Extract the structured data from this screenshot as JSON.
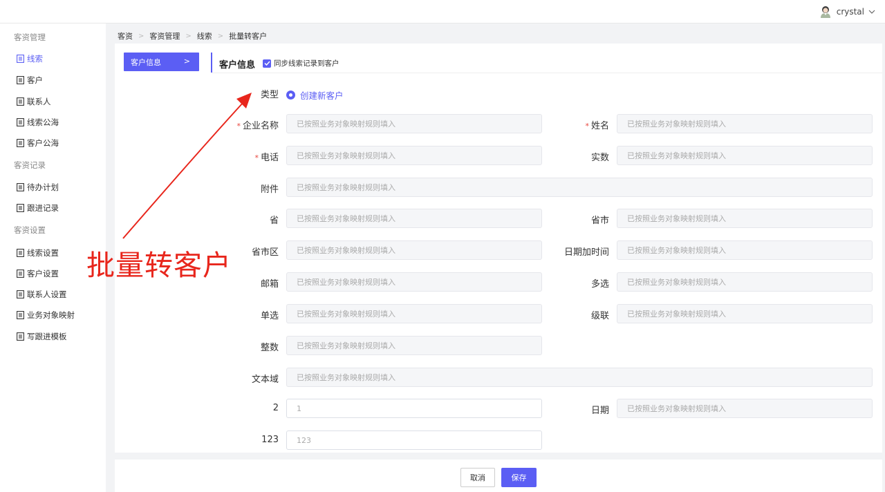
{
  "header": {
    "username": "crystal",
    "dropdown_icon": "chevron-down-icon",
    "avatar_icon": "user-avatar-icon"
  },
  "sidebar": {
    "groups": [
      {
        "label": "客资管理"
      },
      {
        "label": "客资记录"
      },
      {
        "label": "客资设置"
      }
    ],
    "items": [
      {
        "label": "线索",
        "active": true
      },
      {
        "label": "客户"
      },
      {
        "label": "联系人"
      },
      {
        "label": "线索公海"
      },
      {
        "label": "客户公海"
      },
      {
        "label": "待办计划"
      },
      {
        "label": "跟进记录"
      },
      {
        "label": "线索设置"
      },
      {
        "label": "客户设置"
      },
      {
        "label": "联系人设置"
      },
      {
        "label": "业务对象映射"
      },
      {
        "label": "写跟进模板"
      }
    ]
  },
  "breadcrumb": [
    "客资",
    "客资管理",
    "线索",
    "批量转客户"
  ],
  "step": {
    "label": "客户信息",
    "chevron": ">"
  },
  "section": {
    "title": "客户信息",
    "sync_label": "同步线索记录到客户",
    "sync_checked": true
  },
  "form": {
    "type_label": "类型",
    "type_value": "创建新客户",
    "placeholder": "已按照业务对象映射规则填入",
    "fields": {
      "company": "企业名称",
      "name": "姓名",
      "phone": "电话",
      "actual": "实数",
      "attachment": "附件",
      "province": "省",
      "province_city": "省市",
      "province_city_district": "省市区",
      "datetime": "日期加时间",
      "email": "邮箱",
      "multi": "多选",
      "single": "单选",
      "cascade": "级联",
      "integer": "整数",
      "textarea": "文本域",
      "f2": "2",
      "f2_value": "1",
      "date": "日期",
      "f123": "123",
      "f123_value": "123"
    }
  },
  "footer": {
    "cancel_label": "取消",
    "save_label": "保存"
  },
  "annotation": {
    "text": "批量转客户",
    "color": "#e8261c"
  },
  "colors": {
    "accent": "#5b5ef4",
    "required": "#e8453c"
  }
}
